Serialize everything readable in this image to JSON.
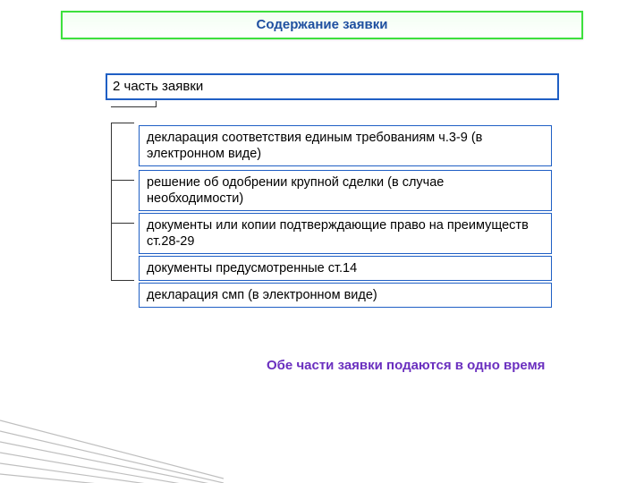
{
  "title": "Содержание заявки",
  "part_label": "2 часть заявки",
  "items": [
    "декларация соответствия единым требованиям ч.3-9 (в электронном виде)",
    "решение об одобрении крупной сделки (в случае необходимости)",
    "документы или копии подтверждающие право на преимуществ ст.28-29",
    "документы предусмотренные ст.14",
    "декларация смп (в электронном виде)"
  ],
  "note": "Обе части заявки подаются в одно время"
}
